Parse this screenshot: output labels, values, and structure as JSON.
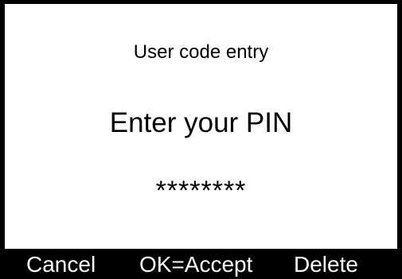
{
  "screen": {
    "subtitle": "User code entry",
    "prompt": "Enter your PIN",
    "pin_mask": "********"
  },
  "softkeys": {
    "cancel": "Cancel",
    "accept": "OK=Accept",
    "delete": "Delete"
  }
}
